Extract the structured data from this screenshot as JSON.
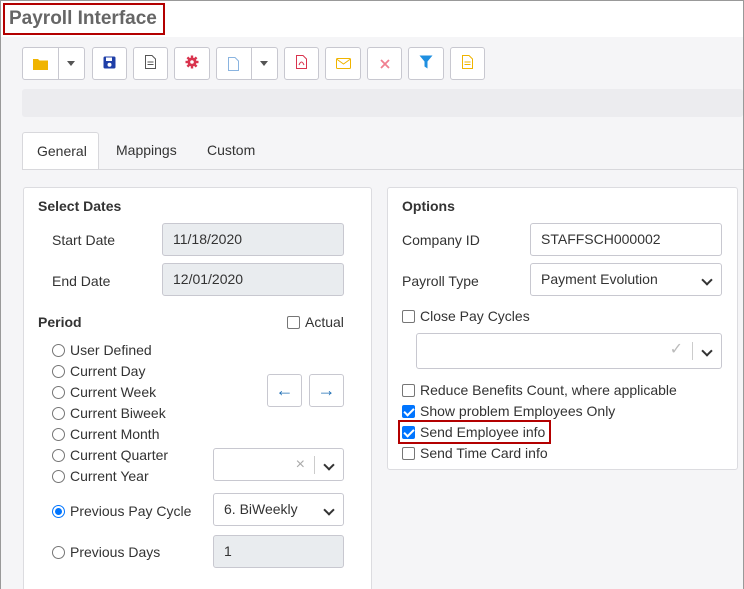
{
  "window": {
    "title": "Payroll Interface"
  },
  "toolbar": {
    "buttons": [
      {
        "name": "open-folder",
        "icon": "folder-icon",
        "color": "#f0b400",
        "has_dropdown": true
      },
      {
        "name": "save",
        "icon": "floppy-disk-icon",
        "color": "#1f3fa8"
      },
      {
        "name": "document",
        "icon": "document-icon",
        "color": "#555555"
      },
      {
        "name": "settings",
        "icon": "gear-icon",
        "color": "#d9334d"
      },
      {
        "name": "new-file",
        "icon": "blank-file-icon",
        "color": "#8ab4e0",
        "has_dropdown": true
      },
      {
        "name": "pdf",
        "icon": "pdf-file-icon",
        "color": "#d9334d"
      },
      {
        "name": "email",
        "icon": "envelope-icon",
        "color": "#f0b400"
      },
      {
        "name": "delete",
        "icon": "close-x-icon",
        "color": "#f08090"
      },
      {
        "name": "filter",
        "icon": "filter-funnel-icon",
        "color": "#1f8fe0"
      },
      {
        "name": "report",
        "icon": "report-file-icon",
        "color": "#f0b400"
      }
    ]
  },
  "tabs": [
    {
      "label": "General",
      "active": true
    },
    {
      "label": "Mappings",
      "active": false
    },
    {
      "label": "Custom",
      "active": false
    }
  ],
  "select_dates": {
    "title": "Select Dates",
    "start_date_label": "Start Date",
    "start_date_value": "11/18/2020",
    "end_date_label": "End Date",
    "end_date_value": "12/01/2020",
    "period_label": "Period",
    "actual_label": "Actual",
    "actual_checked": false,
    "period_options": [
      {
        "label": "User Defined",
        "selected": false
      },
      {
        "label": "Current Day",
        "selected": false
      },
      {
        "label": "Current Week",
        "selected": false
      },
      {
        "label": "Current Biweek",
        "selected": false
      },
      {
        "label": "Current Month",
        "selected": false
      },
      {
        "label": "Current Quarter",
        "selected": false
      },
      {
        "label": "Current Year",
        "selected": false
      },
      {
        "label": "Previous Pay Cycle",
        "selected": true
      },
      {
        "label": "Previous Days",
        "selected": false
      }
    ],
    "prev_arrow": "←",
    "next_arrow": "→",
    "quarter_select_value": "",
    "pay_cycle_select_value": "6. BiWeekly",
    "previous_days_value": "1"
  },
  "options": {
    "title": "Options",
    "company_id_label": "Company ID",
    "company_id_value": "STAFFSCH000002",
    "payroll_type_label": "Payroll Type",
    "payroll_type_value": "Payment Evolution",
    "close_pay_cycles_label": "Close Pay Cycles",
    "close_pay_cycles_checked": false,
    "pay_cycles_select_value": "",
    "checkboxes": [
      {
        "label": "Reduce Benefits Count, where applicable",
        "checked": false
      },
      {
        "label": "Show problem Employees Only",
        "checked": true
      },
      {
        "label": "Send Employee info",
        "checked": true
      },
      {
        "label": "Send Time Card info",
        "checked": false
      }
    ]
  },
  "colors": {
    "accent": "#0075ff",
    "highlight": "#b30000",
    "nav_arrow": "#1f6fb5"
  }
}
